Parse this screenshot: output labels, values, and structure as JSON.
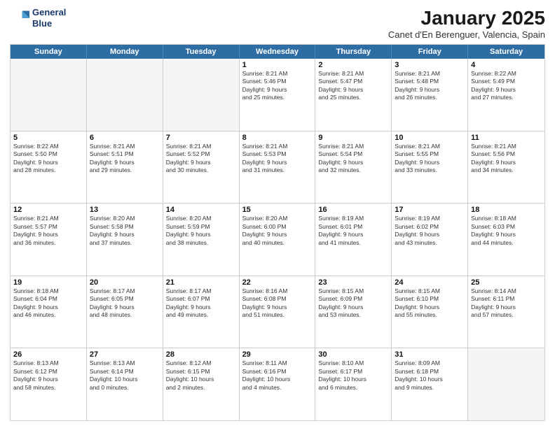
{
  "logo": {
    "line1": "General",
    "line2": "Blue"
  },
  "title": "January 2025",
  "subtitle": "Canet d'En Berenguer, Valencia, Spain",
  "header_days": [
    "Sunday",
    "Monday",
    "Tuesday",
    "Wednesday",
    "Thursday",
    "Friday",
    "Saturday"
  ],
  "rows": [
    [
      {
        "day": "",
        "lines": [],
        "empty": true
      },
      {
        "day": "",
        "lines": [],
        "empty": true
      },
      {
        "day": "",
        "lines": [],
        "empty": true
      },
      {
        "day": "1",
        "lines": [
          "Sunrise: 8:21 AM",
          "Sunset: 5:46 PM",
          "Daylight: 9 hours",
          "and 25 minutes."
        ]
      },
      {
        "day": "2",
        "lines": [
          "Sunrise: 8:21 AM",
          "Sunset: 5:47 PM",
          "Daylight: 9 hours",
          "and 25 minutes."
        ]
      },
      {
        "day": "3",
        "lines": [
          "Sunrise: 8:21 AM",
          "Sunset: 5:48 PM",
          "Daylight: 9 hours",
          "and 26 minutes."
        ]
      },
      {
        "day": "4",
        "lines": [
          "Sunrise: 8:22 AM",
          "Sunset: 5:49 PM",
          "Daylight: 9 hours",
          "and 27 minutes."
        ]
      }
    ],
    [
      {
        "day": "5",
        "lines": [
          "Sunrise: 8:22 AM",
          "Sunset: 5:50 PM",
          "Daylight: 9 hours",
          "and 28 minutes."
        ]
      },
      {
        "day": "6",
        "lines": [
          "Sunrise: 8:21 AM",
          "Sunset: 5:51 PM",
          "Daylight: 9 hours",
          "and 29 minutes."
        ]
      },
      {
        "day": "7",
        "lines": [
          "Sunrise: 8:21 AM",
          "Sunset: 5:52 PM",
          "Daylight: 9 hours",
          "and 30 minutes."
        ]
      },
      {
        "day": "8",
        "lines": [
          "Sunrise: 8:21 AM",
          "Sunset: 5:53 PM",
          "Daylight: 9 hours",
          "and 31 minutes."
        ]
      },
      {
        "day": "9",
        "lines": [
          "Sunrise: 8:21 AM",
          "Sunset: 5:54 PM",
          "Daylight: 9 hours",
          "and 32 minutes."
        ]
      },
      {
        "day": "10",
        "lines": [
          "Sunrise: 8:21 AM",
          "Sunset: 5:55 PM",
          "Daylight: 9 hours",
          "and 33 minutes."
        ]
      },
      {
        "day": "11",
        "lines": [
          "Sunrise: 8:21 AM",
          "Sunset: 5:56 PM",
          "Daylight: 9 hours",
          "and 34 minutes."
        ]
      }
    ],
    [
      {
        "day": "12",
        "lines": [
          "Sunrise: 8:21 AM",
          "Sunset: 5:57 PM",
          "Daylight: 9 hours",
          "and 36 minutes."
        ]
      },
      {
        "day": "13",
        "lines": [
          "Sunrise: 8:20 AM",
          "Sunset: 5:58 PM",
          "Daylight: 9 hours",
          "and 37 minutes."
        ]
      },
      {
        "day": "14",
        "lines": [
          "Sunrise: 8:20 AM",
          "Sunset: 5:59 PM",
          "Daylight: 9 hours",
          "and 38 minutes."
        ]
      },
      {
        "day": "15",
        "lines": [
          "Sunrise: 8:20 AM",
          "Sunset: 6:00 PM",
          "Daylight: 9 hours",
          "and 40 minutes."
        ]
      },
      {
        "day": "16",
        "lines": [
          "Sunrise: 8:19 AM",
          "Sunset: 6:01 PM",
          "Daylight: 9 hours",
          "and 41 minutes."
        ]
      },
      {
        "day": "17",
        "lines": [
          "Sunrise: 8:19 AM",
          "Sunset: 6:02 PM",
          "Daylight: 9 hours",
          "and 43 minutes."
        ]
      },
      {
        "day": "18",
        "lines": [
          "Sunrise: 8:18 AM",
          "Sunset: 6:03 PM",
          "Daylight: 9 hours",
          "and 44 minutes."
        ]
      }
    ],
    [
      {
        "day": "19",
        "lines": [
          "Sunrise: 8:18 AM",
          "Sunset: 6:04 PM",
          "Daylight: 9 hours",
          "and 46 minutes."
        ]
      },
      {
        "day": "20",
        "lines": [
          "Sunrise: 8:17 AM",
          "Sunset: 6:05 PM",
          "Daylight: 9 hours",
          "and 48 minutes."
        ]
      },
      {
        "day": "21",
        "lines": [
          "Sunrise: 8:17 AM",
          "Sunset: 6:07 PM",
          "Daylight: 9 hours",
          "and 49 minutes."
        ]
      },
      {
        "day": "22",
        "lines": [
          "Sunrise: 8:16 AM",
          "Sunset: 6:08 PM",
          "Daylight: 9 hours",
          "and 51 minutes."
        ]
      },
      {
        "day": "23",
        "lines": [
          "Sunrise: 8:15 AM",
          "Sunset: 6:09 PM",
          "Daylight: 9 hours",
          "and 53 minutes."
        ]
      },
      {
        "day": "24",
        "lines": [
          "Sunrise: 8:15 AM",
          "Sunset: 6:10 PM",
          "Daylight: 9 hours",
          "and 55 minutes."
        ]
      },
      {
        "day": "25",
        "lines": [
          "Sunrise: 8:14 AM",
          "Sunset: 6:11 PM",
          "Daylight: 9 hours",
          "and 57 minutes."
        ]
      }
    ],
    [
      {
        "day": "26",
        "lines": [
          "Sunrise: 8:13 AM",
          "Sunset: 6:12 PM",
          "Daylight: 9 hours",
          "and 58 minutes."
        ]
      },
      {
        "day": "27",
        "lines": [
          "Sunrise: 8:13 AM",
          "Sunset: 6:14 PM",
          "Daylight: 10 hours",
          "and 0 minutes."
        ]
      },
      {
        "day": "28",
        "lines": [
          "Sunrise: 8:12 AM",
          "Sunset: 6:15 PM",
          "Daylight: 10 hours",
          "and 2 minutes."
        ]
      },
      {
        "day": "29",
        "lines": [
          "Sunrise: 8:11 AM",
          "Sunset: 6:16 PM",
          "Daylight: 10 hours",
          "and 4 minutes."
        ]
      },
      {
        "day": "30",
        "lines": [
          "Sunrise: 8:10 AM",
          "Sunset: 6:17 PM",
          "Daylight: 10 hours",
          "and 6 minutes."
        ]
      },
      {
        "day": "31",
        "lines": [
          "Sunrise: 8:09 AM",
          "Sunset: 6:18 PM",
          "Daylight: 10 hours",
          "and 9 minutes."
        ]
      },
      {
        "day": "",
        "lines": [],
        "empty": true
      }
    ]
  ]
}
